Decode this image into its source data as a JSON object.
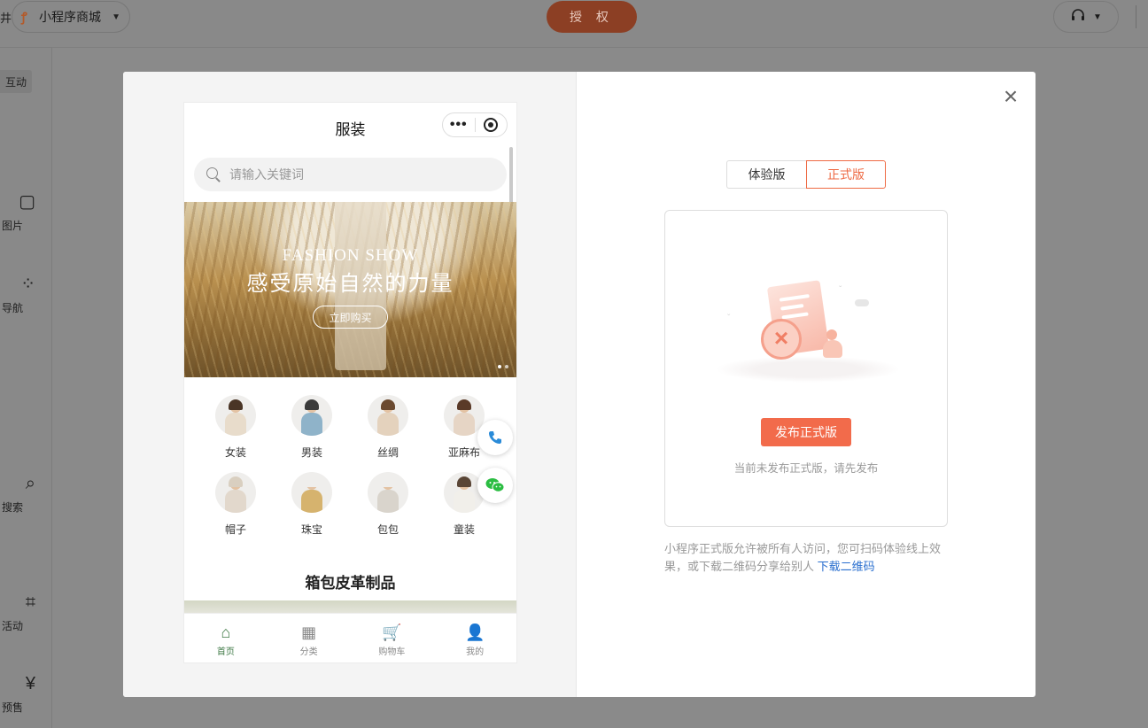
{
  "topbar": {
    "left_cut": "井",
    "app_name": "小程序商城",
    "auth_label": "授 权"
  },
  "sidebar": {
    "items": [
      {
        "label": "互动"
      },
      {
        "label": "图片"
      },
      {
        "label": "导航"
      },
      {
        "label": "搜索"
      },
      {
        "label": "活动"
      },
      {
        "label": "预售"
      }
    ]
  },
  "preview": {
    "title": "服装",
    "search_placeholder": "请输入关键词",
    "banner": {
      "en_title": "FASHION SHOW",
      "zh_title": "感受原始自然的力量",
      "button": "立即购买"
    },
    "categories": [
      {
        "name": "女装",
        "hair": "#4a3526",
        "body": "#e8dccb"
      },
      {
        "name": "男装",
        "hair": "#3b3b3b",
        "body": "#8fb3c9"
      },
      {
        "name": "丝绸",
        "hair": "#6b4a30",
        "body": "#e4d2bd"
      },
      {
        "name": "亚麻布",
        "hair": "#5a3a28",
        "body": "#e6d5c5"
      },
      {
        "name": "帽子",
        "hair": "#d9cfc0",
        "body": "#e2d8cc"
      },
      {
        "name": "珠宝",
        "hair": "#efeeec",
        "body": "#d6b36e"
      },
      {
        "name": "包包",
        "hair": "#efeeec",
        "body": "#d9d4cc"
      },
      {
        "name": "童装",
        "hair": "#5a4636",
        "body": "#f1efea"
      }
    ],
    "section_title": "箱包皮革制品",
    "tabs": [
      {
        "label": "首页",
        "icon": "home-icon",
        "glyph": "⌂",
        "active": true
      },
      {
        "label": "分类",
        "icon": "category-icon",
        "glyph": "▦",
        "active": false
      },
      {
        "label": "购物车",
        "icon": "cart-icon",
        "glyph": "🛒",
        "active": false
      },
      {
        "label": "我的",
        "icon": "user-icon",
        "glyph": "👤",
        "active": false
      }
    ]
  },
  "panel": {
    "tabs": [
      {
        "label": "体验版",
        "active": false
      },
      {
        "label": "正式版",
        "active": true
      }
    ],
    "publish_button": "发布正式版",
    "empty_tip": "当前未发布正式版，请先发布",
    "description": "小程序正式版允许被所有人访问，您可扫码体验线上效果，或下载二维码分享给别人",
    "download_link": "下载二维码"
  },
  "colors": {
    "accent": "#f26b4b",
    "active_tab": "#3f7a46",
    "link": "#2a6fcf"
  }
}
